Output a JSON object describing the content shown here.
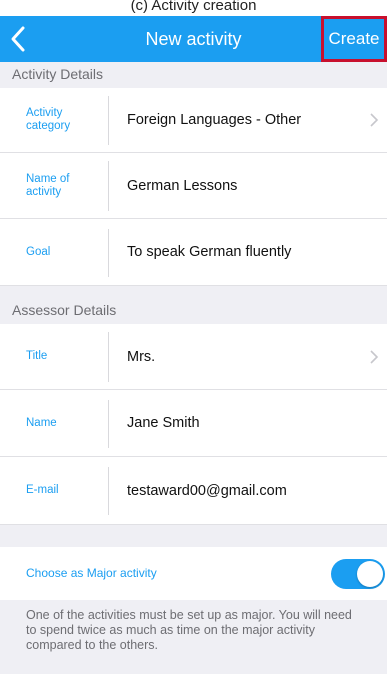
{
  "caption": "(c) Activity creation",
  "navbar": {
    "title": "New activity",
    "create_label": "Create",
    "back_icon": "chevron-left-icon"
  },
  "activity_section": {
    "header": "Activity Details",
    "rows": [
      {
        "label": "Activity category",
        "value": "Foreign Languages - Other",
        "has_chevron": true
      },
      {
        "label": "Name of activity",
        "value": "German Lessons",
        "has_chevron": false
      },
      {
        "label": "Goal",
        "value": "To speak German fluently",
        "has_chevron": false
      }
    ]
  },
  "assessor_section": {
    "header": "Assessor Details",
    "rows": [
      {
        "label": "Title",
        "value": "Mrs.",
        "has_chevron": true
      },
      {
        "label": "Name",
        "value": "Jane Smith",
        "has_chevron": false
      },
      {
        "label": "E-mail",
        "value": "testaward00@gmail.com",
        "has_chevron": false
      }
    ]
  },
  "major_activity": {
    "label": "Choose as Major activity",
    "enabled": true
  },
  "footer_note": "One of the activities must be set up as major. You will need to spend twice as much as time on the major activity compared to the others.",
  "colors": {
    "accent": "#1b9ef1",
    "highlight_border": "#c8102e",
    "section_bg": "#efeff4"
  }
}
